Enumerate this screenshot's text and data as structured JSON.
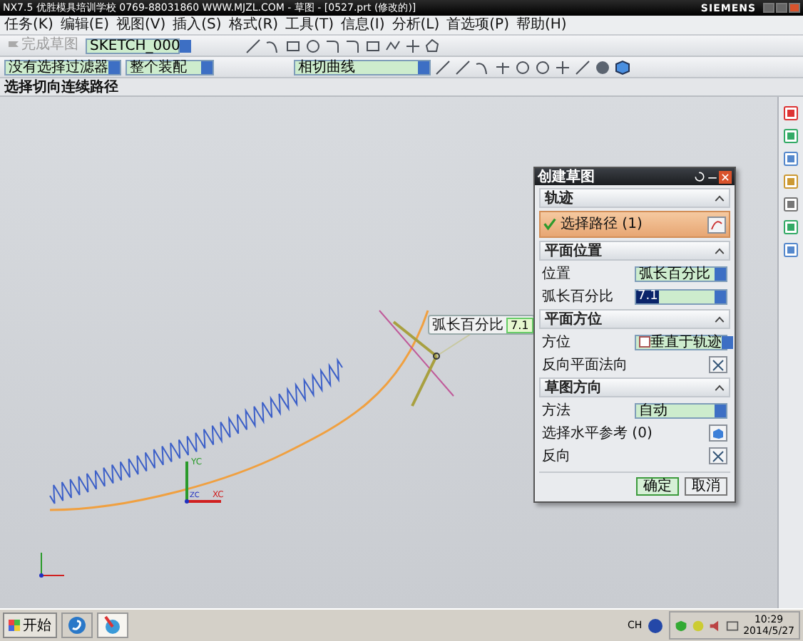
{
  "title_bar": {
    "title": "NX7.5  优胜模具培训学校  0769-88031860  WWW.MJZL.COM - 草图 - [0527.prt (修改的)]",
    "brand": "SIEMENS"
  },
  "menu": [
    "任务(K)",
    "编辑(E)",
    "视图(V)",
    "插入(S)",
    "格式(R)",
    "工具(T)",
    "信息(I)",
    "分析(L)",
    "首选项(P)",
    "帮助(H)"
  ],
  "sketch_toolbar": {
    "finish": "完成草图",
    "finish_disabled": true,
    "sketch_name": "SKETCH_000"
  },
  "selection_bar": {
    "filter": "没有选择过滤器",
    "scope": "整个装配",
    "curve_rule": "相切曲线"
  },
  "cue_line": "选择切向连续路径",
  "canvas": {
    "handle_label": "弧长百分比",
    "handle_value": "7.1",
    "wcs_labels": [
      "YC",
      "XC",
      "ZC"
    ]
  },
  "dialog": {
    "title": "创建草图",
    "sections": [
      {
        "title": "轨迹",
        "expanded": true,
        "rows": [
          {
            "kind": "selection",
            "label": "选择路径 (1)",
            "active": true
          }
        ]
      },
      {
        "title": "平面位置",
        "expanded": true,
        "rows": [
          {
            "kind": "dropdown",
            "label": "位置",
            "value": "弧长百分比"
          },
          {
            "kind": "number",
            "label": "弧长百分比",
            "value": "7.1"
          }
        ]
      },
      {
        "title": "平面方位",
        "expanded": true,
        "rows": [
          {
            "kind": "dropdown",
            "label": "方位",
            "value": "垂直于轨迹",
            "icon": true
          },
          {
            "kind": "toggle",
            "label": "反向平面法向"
          }
        ]
      },
      {
        "title": "草图方向",
        "expanded": true,
        "rows": [
          {
            "kind": "dropdown",
            "label": "方法",
            "value": "自动"
          },
          {
            "kind": "reference",
            "label": "选择水平参考 (0)"
          },
          {
            "kind": "toggle",
            "label": "反向"
          }
        ]
      }
    ],
    "buttons": [
      {
        "label": "确定",
        "default": true
      },
      {
        "label": "取消",
        "default": false
      }
    ]
  },
  "taskbar": {
    "start": "开始",
    "language": "CH",
    "time": "10:29",
    "date": "2014/5/27"
  }
}
